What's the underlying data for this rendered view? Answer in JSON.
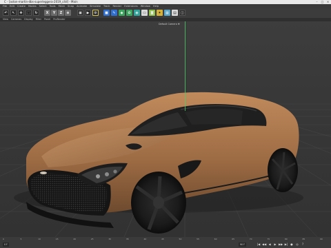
{
  "window": {
    "title": "C - [aston-martin-dbs-superleggera-2019_c4d] - Main",
    "controls": [
      "–",
      "□",
      "×"
    ]
  },
  "menu": {
    "items": [
      "File",
      "Edit",
      "Create",
      "Modes",
      "Select",
      "Tools",
      "Mesh",
      "Snap",
      "Animate",
      "Simulate",
      "Track",
      "Render",
      "Extensions",
      "Window",
      "Help"
    ]
  },
  "toolbar": {
    "buttons": [
      {
        "name": "undo-icon",
        "glyph": "↶",
        "style": "dark"
      },
      {
        "name": "live-select-icon",
        "glyph": "↖",
        "style": "dark"
      },
      {
        "name": "move-icon",
        "glyph": "✥",
        "style": "dark"
      },
      {
        "name": "scale-icon",
        "glyph": "⬚",
        "style": "dark"
      },
      {
        "name": "rotate-icon",
        "glyph": "↻",
        "style": "dark"
      },
      {
        "name": "x-axis-icon",
        "glyph": "X",
        "style": "gray"
      },
      {
        "name": "y-axis-icon",
        "glyph": "Y",
        "style": "gray"
      },
      {
        "name": "z-axis-icon",
        "glyph": "Z",
        "style": "gray"
      },
      {
        "name": "coordinate-system-icon",
        "glyph": "⊕",
        "style": "gray"
      },
      {
        "name": "render-view-icon",
        "glyph": "▣",
        "style": "dark"
      },
      {
        "name": "render-picture-viewer-icon",
        "glyph": "▶",
        "style": "dark"
      },
      {
        "name": "render-settings-icon",
        "glyph": "⚙",
        "style": "outline"
      },
      {
        "name": "cube-icon",
        "glyph": "■",
        "style": "blue"
      },
      {
        "name": "spline-pen-icon",
        "glyph": "✎",
        "style": "blue"
      },
      {
        "name": "subdivision-surface-icon",
        "glyph": "◆",
        "style": "green"
      },
      {
        "name": "array-icon",
        "glyph": "✿",
        "style": "green"
      },
      {
        "name": "deformer-icon",
        "glyph": "◉",
        "style": "teal"
      },
      {
        "name": "floor-icon",
        "glyph": "▭",
        "style": "light"
      },
      {
        "name": "camera-icon",
        "glyph": "◙",
        "style": "lime"
      },
      {
        "name": "light-icon",
        "glyph": "✦",
        "style": "yellow"
      },
      {
        "name": "layout-grid-icon",
        "glyph": "▦",
        "style": "cyan"
      },
      {
        "name": "display-mode-icon",
        "glyph": "▤",
        "style": "light"
      },
      {
        "name": "workplane-icon",
        "glyph": "◫",
        "style": "dark"
      }
    ]
  },
  "viewport_menu": {
    "items": [
      "View",
      "Cameras",
      "Display",
      "Filter",
      "Panel",
      "ProRender"
    ]
  },
  "viewport": {
    "camera_label": "Default Camera ✥"
  },
  "timeline": {
    "ticks": [
      "0",
      "5",
      "10",
      "15",
      "20",
      "25",
      "30",
      "35",
      "40",
      "45",
      "50",
      "55",
      "60",
      "65",
      "70",
      "75",
      "80",
      "85",
      "90"
    ],
    "start_frame": "0 F",
    "current_frame": "90 F",
    "end_frame": "90 F",
    "playback_buttons": [
      "|◀",
      "◀◀",
      "◀",
      "▶",
      "▶▶",
      "▶|",
      "●",
      "◎",
      "?"
    ]
  },
  "colors": {
    "car_body": "#a8764c",
    "accent_axis": "#4fd06a"
  }
}
